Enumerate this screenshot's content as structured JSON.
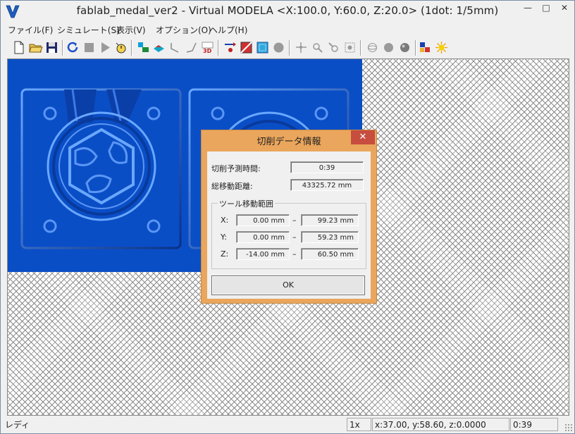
{
  "window": {
    "title": "fablab_medal_ver2 - Virtual MODELA <X:100.0, Y:60.0, Z:20.0> (1dot: 1/5mm)",
    "minimize": "—",
    "maximize": "□",
    "close": "✕"
  },
  "menu": [
    {
      "label": "ファイル(F)"
    },
    {
      "label": "シミュレート(S)"
    },
    {
      "label": "表示(V)"
    },
    {
      "label": "オプション(O)"
    },
    {
      "label": "ヘルプ(H)"
    }
  ],
  "colors": {
    "model_blue": "#0a4ec6",
    "dialog_frame": "#eaa65c",
    "close_red": "#c74d3e"
  },
  "dialog": {
    "title": "切削データ情報",
    "close": "✕",
    "time_label": "切削予測時間:",
    "time_value": "0:39",
    "distance_label": "総移動距離:",
    "distance_value": "43325.72 mm",
    "range_title": "ツール移動範囲",
    "rows": [
      {
        "axis": "X:",
        "min": "0.00 mm",
        "max": "99.23 mm"
      },
      {
        "axis": "Y:",
        "min": "0.00 mm",
        "max": "59.23 mm"
      },
      {
        "axis": "Z:",
        "min": "-14.00 mm",
        "max": "60.50 mm"
      }
    ],
    "dash": "–",
    "ok": "OK"
  },
  "status": {
    "left": "レディ",
    "zoom": "1x",
    "coords": "x:37.00, y:58.60, z:0.0000",
    "time": "0:39"
  }
}
